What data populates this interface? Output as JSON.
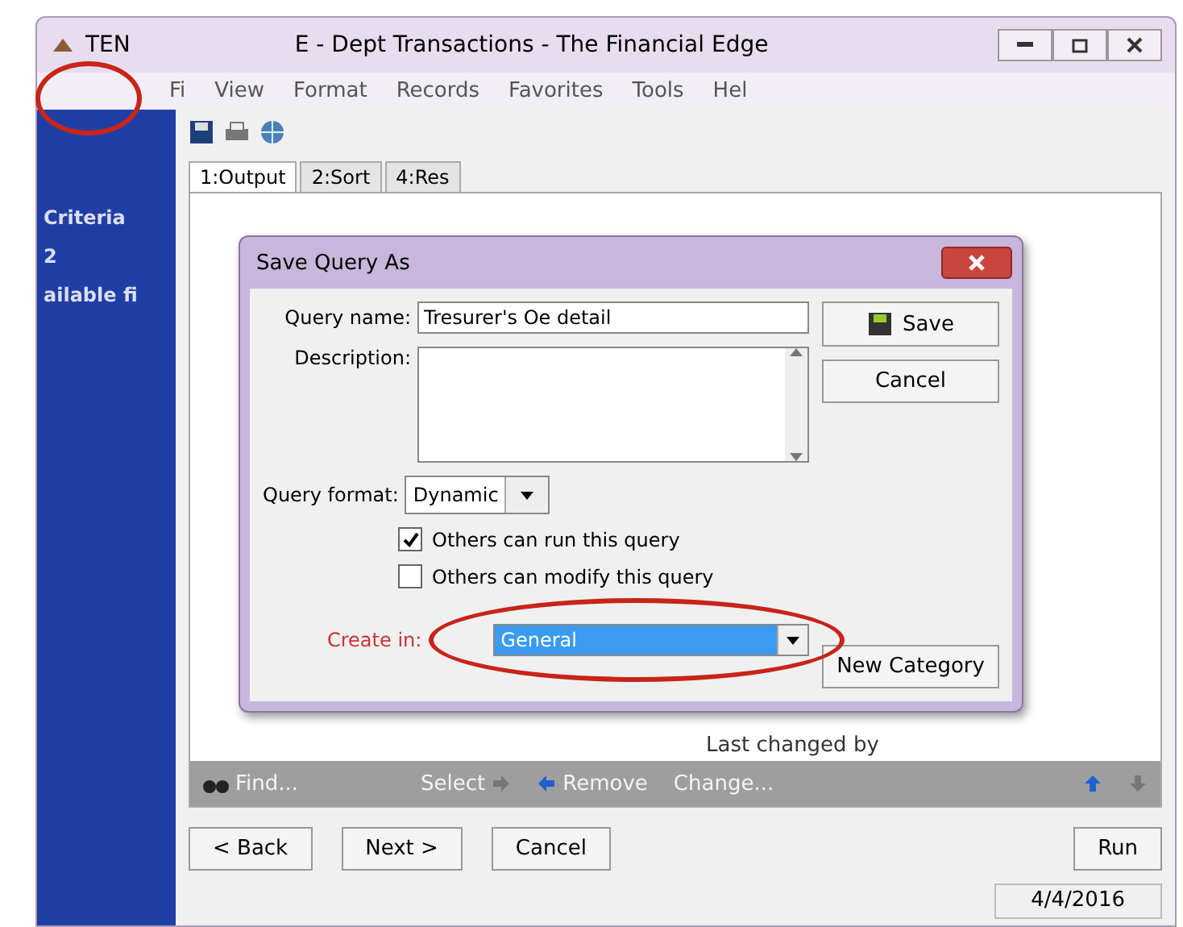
{
  "window": {
    "title_start": "TEN",
    "title_rest": "E - Dept Transactions - The Financial Edge"
  },
  "menu": [
    "Fi",
    "View",
    "Format",
    "Records",
    "Favorites",
    "Tools",
    "Hel"
  ],
  "sidebar": {
    "items": [
      "Criteria",
      "2",
      "ailable fi"
    ]
  },
  "tabs": [
    {
      "label": "1:Output",
      "selected": true
    },
    {
      "label": "2:Sort",
      "selected": false
    },
    {
      "label": "4:Res",
      "selected": false
    }
  ],
  "list": {
    "column": "Last changed by"
  },
  "list_toolbar": {
    "find": "Find...",
    "select": "Select",
    "remove": "Remove",
    "change": "Change..."
  },
  "buttons": {
    "back": "< Back",
    "next": "Next >",
    "cancel": "Cancel",
    "run": "Run"
  },
  "status_bar": {
    "date": "4/4/2016"
  },
  "dialog": {
    "title": "Save Query As",
    "name_label": "Query name:",
    "name_value": "Tresurer's Oe detail",
    "description_label": "Description:",
    "format_label": "Query format:",
    "format_value": "Dynamic",
    "options": [
      {
        "label": "Others can run this query",
        "checked": true
      },
      {
        "label": "Others can modify this query",
        "checked": false
      }
    ],
    "create_label": "Create in:",
    "create_value": "General",
    "save": "Save",
    "cancel": "Cancel",
    "new_category": "New Category"
  }
}
